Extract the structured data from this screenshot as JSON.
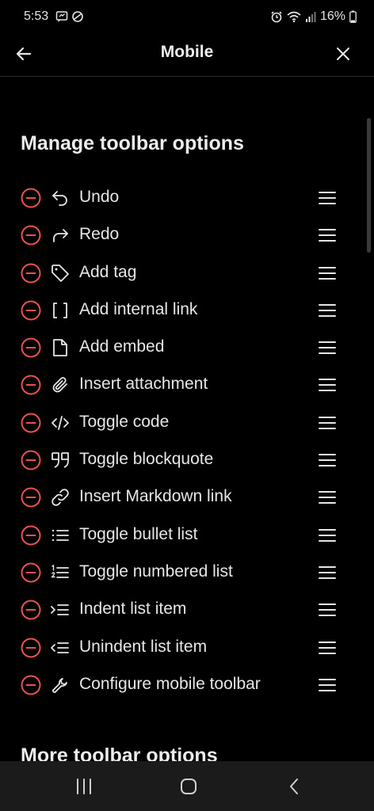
{
  "status_bar": {
    "time": "5:53",
    "battery": "16%"
  },
  "header": {
    "title": "Mobile"
  },
  "sections": {
    "manage_title": "Manage toolbar options",
    "more_title": "More toolbar options"
  },
  "toolbar_items": [
    {
      "label": "Undo",
      "icon": "undo-icon"
    },
    {
      "label": "Redo",
      "icon": "redo-icon"
    },
    {
      "label": "Add tag",
      "icon": "tag-icon"
    },
    {
      "label": "Add internal link",
      "icon": "brackets-icon"
    },
    {
      "label": "Add embed",
      "icon": "file-icon"
    },
    {
      "label": "Insert attachment",
      "icon": "paperclip-icon"
    },
    {
      "label": "Toggle code",
      "icon": "code-icon"
    },
    {
      "label": "Toggle blockquote",
      "icon": "quote-icon"
    },
    {
      "label": "Insert Markdown link",
      "icon": "link-icon"
    },
    {
      "label": "Toggle bullet list",
      "icon": "bullet-list-icon"
    },
    {
      "label": "Toggle numbered list",
      "icon": "numbered-list-icon"
    },
    {
      "label": "Indent list item",
      "icon": "indent-icon"
    },
    {
      "label": "Unindent list item",
      "icon": "unindent-icon"
    },
    {
      "label": "Configure mobile toolbar",
      "icon": "wrench-icon"
    }
  ],
  "colors": {
    "background": "#000000",
    "text": "#e6e6e6",
    "remove_accent": "#e5534b",
    "nav_bar": "#1b1b1b"
  }
}
